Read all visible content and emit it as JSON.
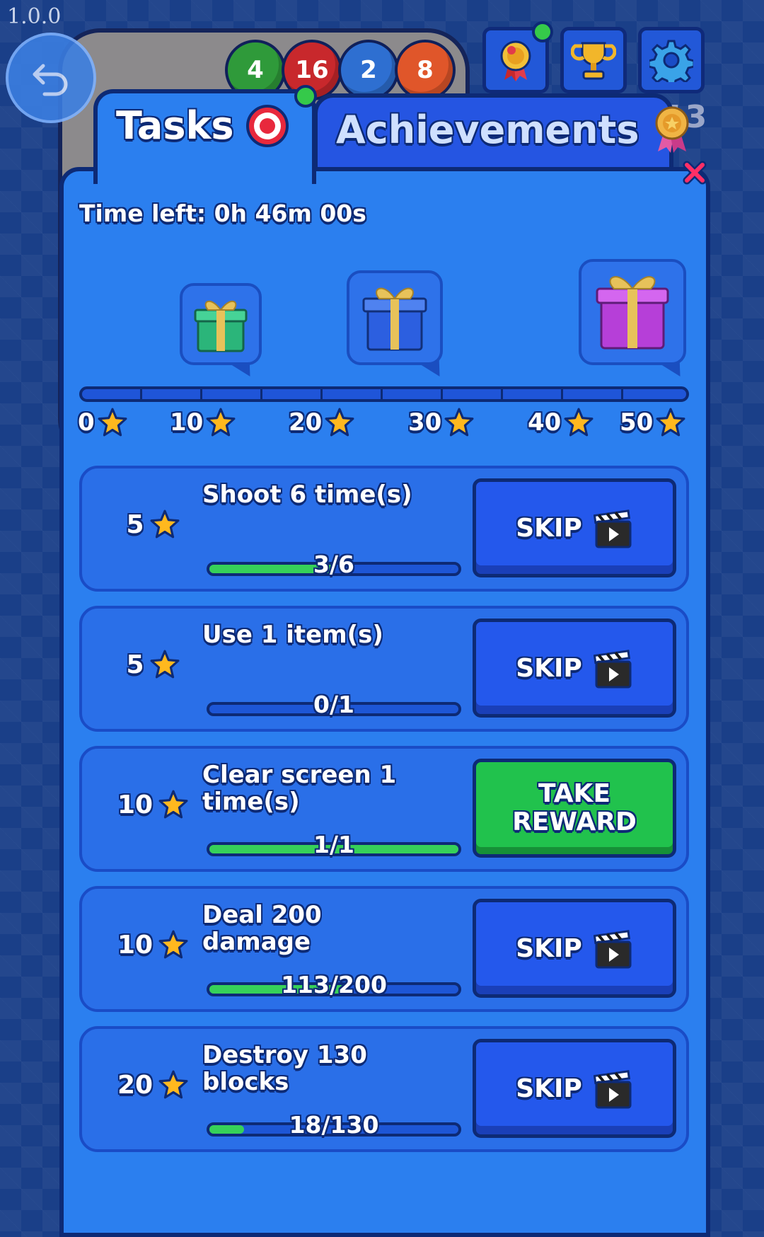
{
  "version": "1.0.0",
  "board": {
    "balls": [
      {
        "value": "4",
        "color": "#2f9a3a"
      },
      {
        "value": "16",
        "color": "#c8282c"
      },
      {
        "value": "2",
        "color": "#2e6fd1"
      },
      {
        "value": "8",
        "color": "#e0562a"
      }
    ],
    "score": "13"
  },
  "tabs": {
    "tasks_label": "Tasks",
    "achievements_label": "Achievements"
  },
  "time_left": "Time left: 0h 46m 00s",
  "reward_track": {
    "progress": 0,
    "milestones": [
      {
        "value": "0"
      },
      {
        "value": "10"
      },
      {
        "value": "20"
      },
      {
        "value": "30"
      },
      {
        "value": "40"
      },
      {
        "value": "50"
      }
    ],
    "gifts": [
      {
        "name": "gift-green-icon",
        "color": "#2bb57a"
      },
      {
        "name": "gift-blue-icon",
        "color": "#2c5fe0"
      },
      {
        "name": "gift-purple-icon",
        "color": "#b63fd8"
      }
    ]
  },
  "tasks": [
    {
      "stars": "5",
      "title": "Shoot 6 time(s)",
      "progress_text": "3/6",
      "progress": 0.5,
      "action": "SKIP"
    },
    {
      "stars": "5",
      "title": "Use 1 item(s)",
      "progress_text": "0/1",
      "progress": 0,
      "action": "SKIP"
    },
    {
      "stars": "10",
      "title": "Clear screen 1 time(s)",
      "progress_text": "1/1",
      "progress": 1,
      "action_line1": "TAKE",
      "action_line2": "REWARD"
    },
    {
      "stars": "10",
      "title": "Deal 200 damage",
      "progress_text": "113/200",
      "progress": 0.565,
      "action": "SKIP"
    },
    {
      "stars": "20",
      "title": "Destroy 130 blocks",
      "progress_text": "18/130",
      "progress": 0.138,
      "action": "SKIP"
    }
  ],
  "colors": {
    "panel": "#2b7fef",
    "outline": "#0d2a75",
    "progress_green": "#36d159",
    "star": "#ffb81e",
    "take_reward": "#21c24d"
  }
}
